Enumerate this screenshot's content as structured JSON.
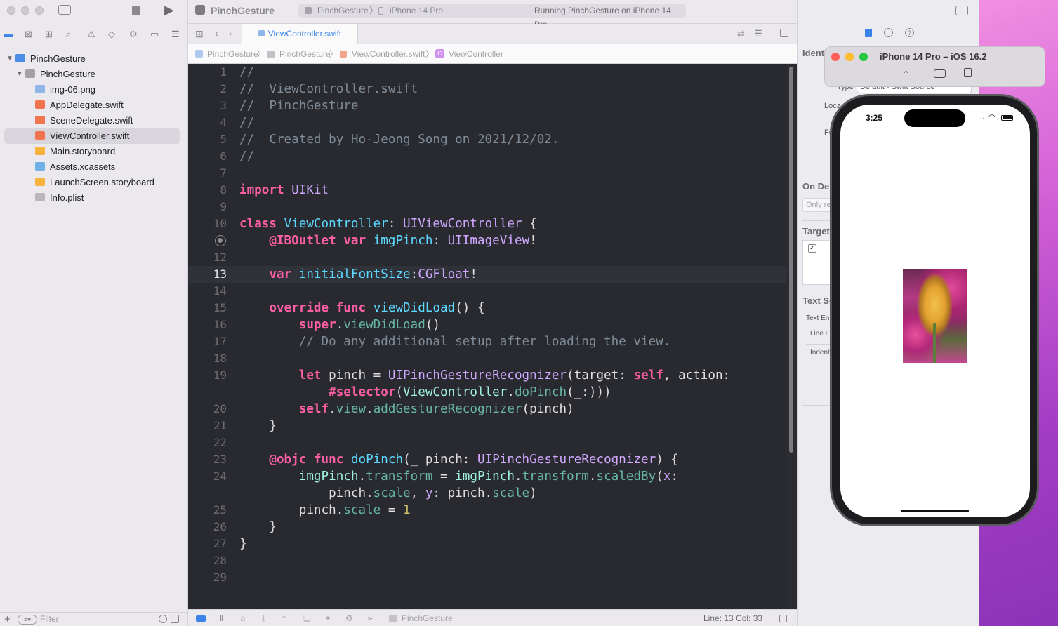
{
  "navigator": {
    "project_name": "PinchGesture",
    "group_name": "PinchGesture",
    "files": [
      {
        "name": "img-06.png",
        "kind": "image"
      },
      {
        "name": "AppDelegate.swift",
        "kind": "swift"
      },
      {
        "name": "SceneDelegate.swift",
        "kind": "swift"
      },
      {
        "name": "ViewController.swift",
        "kind": "swift",
        "selected": true
      },
      {
        "name": "Main.storyboard",
        "kind": "storyboard"
      },
      {
        "name": "Assets.xcassets",
        "kind": "assets"
      },
      {
        "name": "LaunchScreen.storyboard",
        "kind": "storyboard"
      },
      {
        "name": "Info.plist",
        "kind": "plist"
      }
    ],
    "filter_placeholder": "Filter"
  },
  "toolbar": {
    "project_title": "PinchGesture",
    "scheme": "PinchGesture",
    "destination": "iPhone 14 Pro",
    "status": "Running PinchGesture on iPhone 14 Pro"
  },
  "editor": {
    "active_tab": "ViewController.swift",
    "breadcrumb": [
      "PinchGesture",
      "PinchGesture",
      "ViewController.swift",
      "ViewController"
    ],
    "line_numbers": [
      "1",
      "2",
      "3",
      "4",
      "5",
      "6",
      "7",
      "8",
      "9",
      "10",
      "",
      "12",
      "13",
      "14",
      "15",
      "16",
      "17",
      "18",
      "19",
      "",
      "20",
      "21",
      "22",
      "23",
      "24",
      "",
      "25",
      "26",
      "27",
      "28",
      "29"
    ],
    "current_line": "13",
    "code_lines": [
      "//",
      "//  ViewController.swift",
      "//  PinchGesture",
      "//",
      "//  Created by Ho-Jeong Song on 2021/12/02.",
      "//",
      "",
      "import UIKit",
      "",
      "class ViewController: UIViewController {",
      "    @IBOutlet var imgPinch: UIImageView!",
      "",
      "    var initialFontSize:CGFloat!",
      "",
      "    override func viewDidLoad() {",
      "        super.viewDidLoad()",
      "        // Do any additional setup after loading the view.",
      "",
      "        let pinch = UIPinchGestureRecognizer(target: self, action:",
      "            #selector(ViewController.doPinch(_:)))",
      "        self.view.addGestureRecognizer(pinch)",
      "    }",
      "",
      "    @objc func doPinch(_ pinch: UIPinchGestureRecognizer) {",
      "        imgPinch.transform = imgPinch.transform.scaledBy(x:",
      "            pinch.scale, y: pinch.scale)",
      "        pinch.scale = 1",
      "    }",
      "}",
      "",
      ""
    ]
  },
  "statusbar": {
    "scheme": "PinchGesture",
    "position": "Line: 13  Col: 33"
  },
  "inspector": {
    "section_identity": "Identi",
    "type_label": "Type",
    "type_value": "Default - Swift Source",
    "location_label": "Loca",
    "fullpath_label": "Fu",
    "on_demand_label": "On De",
    "only_placeholder": "Only re",
    "target_label": "Target",
    "text_settings_label": "Text Se",
    "text_encoding_label": "Text En",
    "line_endings_label": "Line E",
    "indent_label": "Indent"
  },
  "simulator": {
    "title": "iPhone 14 Pro – iOS 16.2",
    "time": "3:25",
    "signal": "....",
    "colors": {
      "wallpaper": "#c44fd0",
      "photo_flower": "#e3a12f",
      "photo_background": "#b53a86"
    }
  },
  "colors": {
    "editor_bg": "#292a30",
    "keyword": "#fc5fa3",
    "type": "#d0a8ff",
    "comment": "#7f8c98",
    "decl": "#5dd8ff",
    "project_type": "#9ef1dd",
    "project_func": "#67b7a4",
    "number": "#d0bf69",
    "accent": "#3b83e8"
  }
}
